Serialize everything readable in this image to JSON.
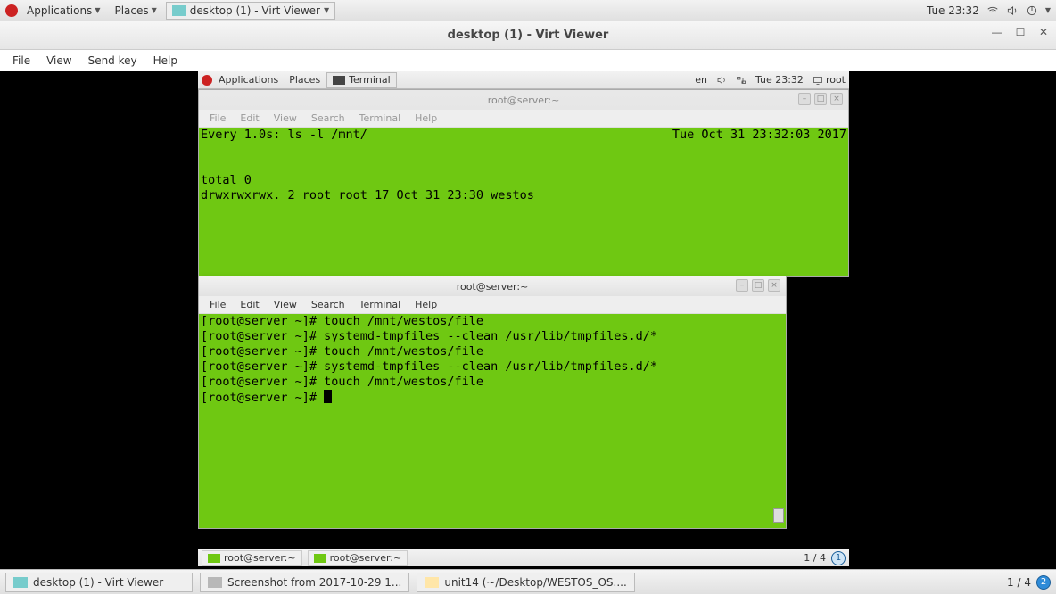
{
  "outer_topbar": {
    "applications": "Applications",
    "places": "Places",
    "current_task": "desktop (1) - Virt Viewer",
    "clock": "Tue 23:32"
  },
  "viewer_window": {
    "title": "desktop (1) - Virt Viewer",
    "menu": {
      "file": "File",
      "view": "View",
      "sendkey": "Send key",
      "help": "Help"
    }
  },
  "guest_topbar": {
    "applications": "Applications",
    "places": "Places",
    "terminal_task": "Terminal",
    "lang": "en",
    "clock": "Tue 23:32",
    "user": "root"
  },
  "term_menu": {
    "file": "File",
    "edit": "Edit",
    "view": "View",
    "search": "Search",
    "terminal": "Terminal",
    "help": "Help"
  },
  "term1": {
    "title": "root@server:~",
    "watch_cmd": "Every 1.0s: ls -l /mnt/",
    "watch_time": "Tue Oct 31 23:32:03 2017",
    "body_l1": "total 0",
    "body_l2": "drwxrwxrwx. 2 root root 17 Oct 31 23:30 westos"
  },
  "term2": {
    "title": "root@server:~",
    "lines": [
      "[root@server ~]# touch /mnt/westos/file",
      "[root@server ~]# systemd-tmpfiles --clean /usr/lib/tmpfiles.d/*",
      "[root@server ~]# touch /mnt/westos/file",
      "[root@server ~]# systemd-tmpfiles --clean /usr/lib/tmpfiles.d/*",
      "[root@server ~]# touch /mnt/westos/file"
    ],
    "prompt": "[root@server ~]# "
  },
  "guest_bottombar": {
    "task1": "root@server:~",
    "task2": "root@server:~",
    "workspace": "1 / 4",
    "badge": "1"
  },
  "outer_bottombar": {
    "task1": "desktop (1) - Virt Viewer",
    "task2": "Screenshot from 2017-10-29 1...",
    "task3": "unit14 (~/Desktop/WESTOS_OS....",
    "workspace": "1 / 4",
    "badge": "2"
  }
}
